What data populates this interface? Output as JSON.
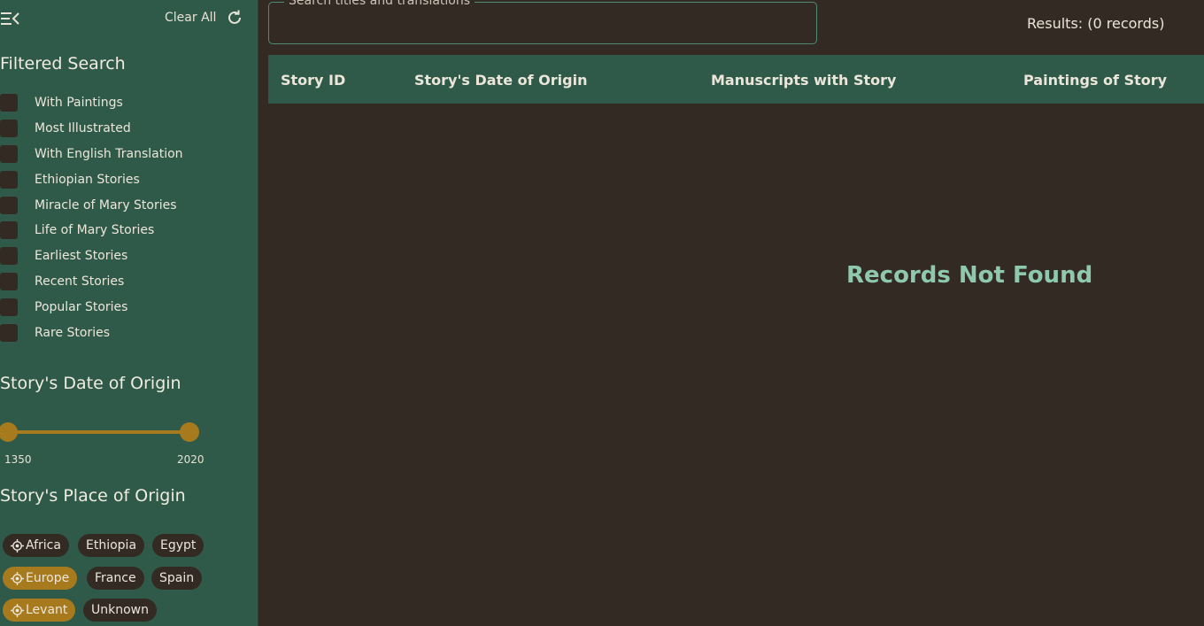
{
  "sidebar": {
    "clear_all_label": "Clear All",
    "filtered_search_title": "Filtered Search",
    "filters": [
      "With Paintings",
      "Most Illustrated",
      "With English Translation",
      "Ethiopian Stories",
      "Miracle of Mary Stories",
      "Life of Mary Stories",
      "Earliest Stories",
      "Recent Stories",
      "Popular Stories",
      "Rare Stories"
    ],
    "date_title": "Story's Date of Origin",
    "date_range": {
      "min": "1350",
      "max": "2020"
    },
    "place_title": "Story's Place of Origin",
    "places": [
      {
        "label": "Africa",
        "region": true,
        "active": false
      },
      {
        "label": "Ethiopia",
        "region": false,
        "active": false
      },
      {
        "label": "Egypt",
        "region": false,
        "active": false
      },
      {
        "label": "Europe",
        "region": true,
        "active": true
      },
      {
        "label": "France",
        "region": false,
        "active": false
      },
      {
        "label": "Spain",
        "region": false,
        "active": false
      },
      {
        "label": "Levant",
        "region": true,
        "active": true
      },
      {
        "label": "Unknown",
        "region": false,
        "active": false
      }
    ]
  },
  "search": {
    "label": "Search titles and translations",
    "value": ""
  },
  "results_label": "Results: (0 records)",
  "table": {
    "columns": [
      "Story ID",
      "Story's Date of Origin",
      "Manuscripts with Story",
      "Paintings of Story"
    ]
  },
  "empty_message": "Records Not Found",
  "colors": {
    "sidebar": "#2f5a4a",
    "background": "#342a24",
    "accent": "#a77a1d",
    "empty_text": "#8fc9ad"
  }
}
